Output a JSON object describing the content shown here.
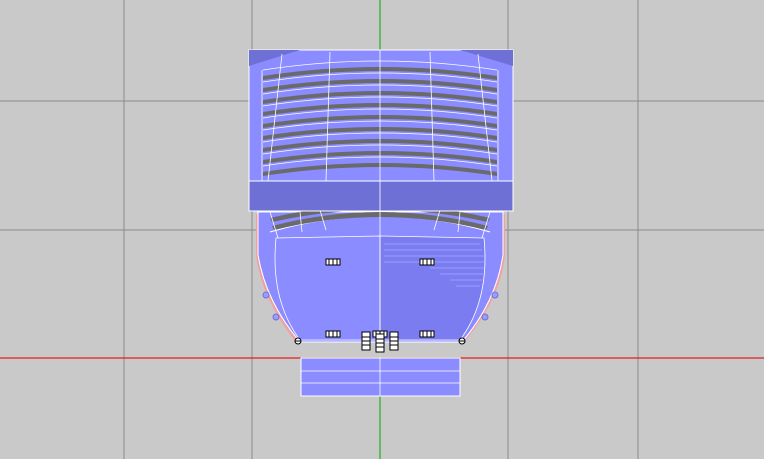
{
  "viewport": {
    "view": "top",
    "background_color": "#c9c9c9",
    "grid_color": "#8a8a8a",
    "axis_x_color": "#e02020",
    "axis_y_color": "#20b020"
  },
  "model": {
    "face_color": "#8a8cff",
    "face_dark_color": "#6f70d6",
    "edge_color": "#ffffff",
    "slot_color": "#6a6a6a",
    "side_color": "#f0a0a0",
    "icons": [
      "speaker-icon",
      "fixture-icon",
      "gizmo-icon"
    ]
  }
}
